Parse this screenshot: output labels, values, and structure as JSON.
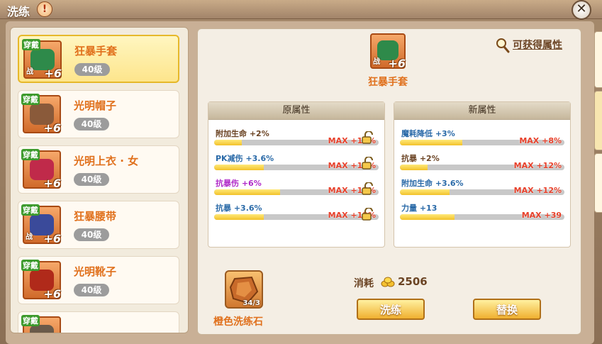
{
  "window": {
    "title": "洗练",
    "warn_symbol": "!",
    "close_symbol": "✕"
  },
  "items": [
    {
      "tag": "穿戴",
      "name": "狂暴手套",
      "level": "40级",
      "plus": "+6",
      "battle": "战",
      "art_color": "#2e8a4a"
    },
    {
      "tag": "穿戴",
      "name": "光明帽子",
      "level": "40级",
      "plus": "+6",
      "battle": "",
      "art_color": "#8a5a3a"
    },
    {
      "tag": "穿戴",
      "name": "光明上衣 · 女",
      "level": "40级",
      "plus": "+6",
      "battle": "",
      "art_color": "#c02a4a"
    },
    {
      "tag": "穿戴",
      "name": "狂暴腰带",
      "level": "40级",
      "plus": "+6",
      "battle": "战",
      "art_color": "#3a4a9a"
    },
    {
      "tag": "穿戴",
      "name": "光明靴子",
      "level": "40级",
      "plus": "+6",
      "battle": "",
      "art_color": "#b02a1a"
    },
    {
      "tag": "穿戴",
      "name": "",
      "level": "",
      "plus": "",
      "battle": "",
      "art_color": "#6a5a4a"
    }
  ],
  "equip": {
    "name": "狂暴手套",
    "plus": "+6",
    "battle": "战",
    "art_color": "#2e8a4a"
  },
  "obtainable_link": "可获得属性",
  "original": {
    "header": "原属性",
    "rows": [
      {
        "label": "附加生命  +2%",
        "max": "MAX  +12%",
        "fill": 0.17,
        "color": "#2a6aa8"
      },
      {
        "label": "PK减伤  +3.6%",
        "max": "MAX  +12%",
        "fill": 0.3,
        "color": "#2a6aa8"
      },
      {
        "label": "抗暴伤  +6%",
        "max": "MAX  +15%",
        "fill": 0.4,
        "color": "#b02ac8"
      },
      {
        "label": "抗暴  +3.6%",
        "max": "MAX  +12%",
        "fill": 0.3,
        "color": "#2a6aa8"
      }
    ]
  },
  "new": {
    "header": "新属性",
    "rows": [
      {
        "label": "魔耗降低  +3%",
        "max": "MAX  +8%",
        "fill": 0.38,
        "color": "#2a6aa8"
      },
      {
        "label": "抗暴  +2%",
        "max": "MAX  +12%",
        "fill": 0.17,
        "color": "#6b4424"
      },
      {
        "label": "附加生命  +3.6%",
        "max": "MAX  +12%",
        "fill": 0.3,
        "color": "#2a6aa8"
      },
      {
        "label": "力量  +13",
        "max": "MAX  +39",
        "fill": 0.33,
        "color": "#2a6aa8"
      }
    ]
  },
  "stone": {
    "name": "橙色洗练石",
    "count": "34/3"
  },
  "cost": {
    "label": "消耗",
    "value": "2506"
  },
  "buttons": {
    "refine": "洗练",
    "replace": "替换"
  }
}
